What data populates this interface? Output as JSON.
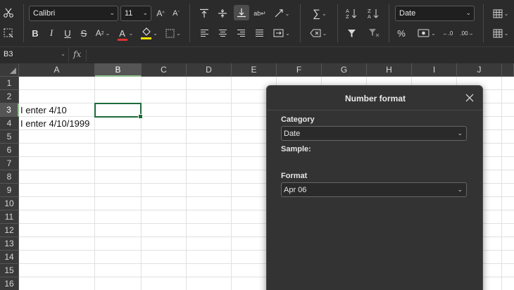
{
  "ribbon": {
    "font_name": "Calibri",
    "font_size": "11",
    "number_format": "Date",
    "underline_color": "#e03131",
    "highlight_color": "#f2e100"
  },
  "formula_bar": {
    "name_box": "B3",
    "fx_label": "fx",
    "content": ""
  },
  "sheet": {
    "columns": [
      "A",
      "B",
      "C",
      "D",
      "E",
      "F",
      "G",
      "H",
      "I",
      "J"
    ],
    "rows": [
      "1",
      "2",
      "3",
      "4",
      "5",
      "6",
      "7",
      "8",
      "9",
      "10",
      "11",
      "12",
      "13",
      "14",
      "15",
      "16"
    ],
    "selected_column": "B",
    "selected_row": "3",
    "cells": {
      "A3": "I enter 4/10",
      "A4": "I enter 4/10/1999"
    }
  },
  "number_format_pane": {
    "title": "Number format",
    "category_label": "Category",
    "category_value": "Date",
    "sample_label": "Sample:",
    "format_label": "Format",
    "format_value": "Apr 06"
  }
}
